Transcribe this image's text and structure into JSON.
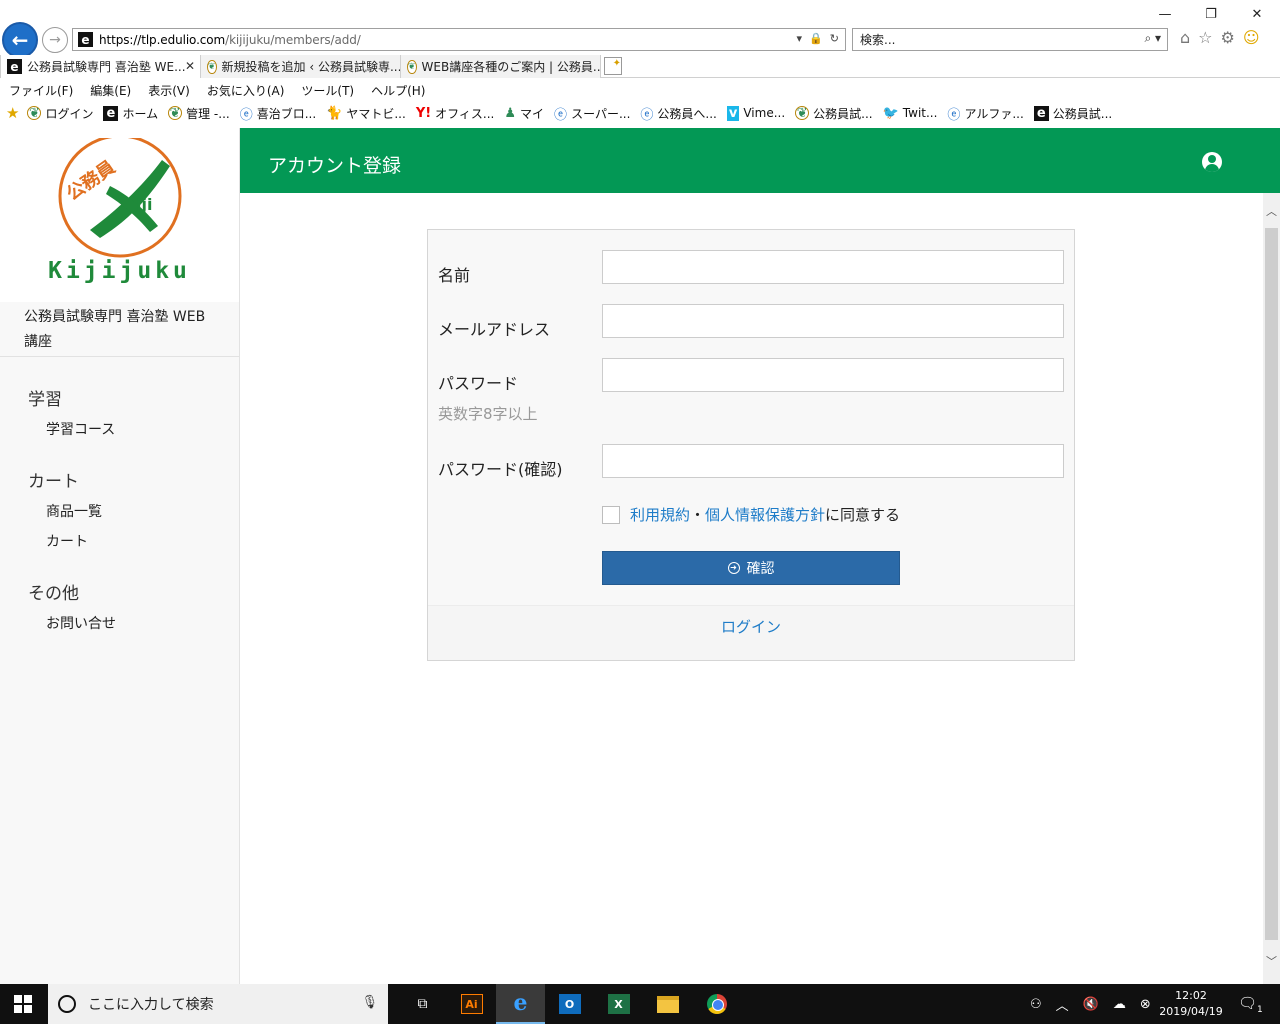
{
  "browser": {
    "url_host": "https://tlp.edulio.com",
    "url_path": "/kijijuku/members/add/",
    "search_placeholder": "検索...",
    "tabs": [
      {
        "label": "公務員試験専門 喜治塾 WE..."
      },
      {
        "label": "新規投稿を追加 ‹ 公務員試験専..."
      },
      {
        "label": "WEB講座各種のご案内 | 公務員..."
      }
    ],
    "menu": [
      "ファイル(F)",
      "編集(E)",
      "表示(V)",
      "お気に入り(A)",
      "ツール(T)",
      "ヘルプ(H)"
    ],
    "favorites": [
      "ログイン",
      "ホーム",
      "管理 -...",
      "喜治ブロ...",
      "ヤマトビ...",
      "オフィス...",
      "マイ",
      "スーパー...",
      "公務員へ...",
      "Vime...",
      "公務員試...",
      "Twit...",
      "アルファ...",
      "公務員試..."
    ]
  },
  "sidebar": {
    "logo_badge": "公務員",
    "logo_text": "Kijijuku",
    "site_name": "公務員試験専門 喜治塾 WEB講座",
    "sections": [
      {
        "title": "学習",
        "links": [
          "学習コース"
        ]
      },
      {
        "title": "カート",
        "links": [
          "商品一覧",
          "カート"
        ]
      },
      {
        "title": "その他",
        "links": [
          "お問い合せ"
        ]
      }
    ]
  },
  "header": {
    "title": "アカウント登録"
  },
  "form": {
    "name_label": "名前",
    "email_label": "メールアドレス",
    "password_label": "パスワード",
    "password_hint": "英数字8字以上",
    "password_confirm_label": "パスワード(確認)",
    "terms_link": "利用規約",
    "separator": "・",
    "privacy_link": "個人情報保護方針",
    "agree_suffix": "に同意する",
    "submit_label": "確認",
    "login_link": "ログイン"
  },
  "taskbar": {
    "search_placeholder": "ここに入力して検索",
    "time": "12:02",
    "date": "2019/04/19",
    "notification_count": "1"
  },
  "colors": {
    "header_green": "#039855",
    "button_blue": "#2b6aa8",
    "link_blue": "#1e7cc8"
  }
}
